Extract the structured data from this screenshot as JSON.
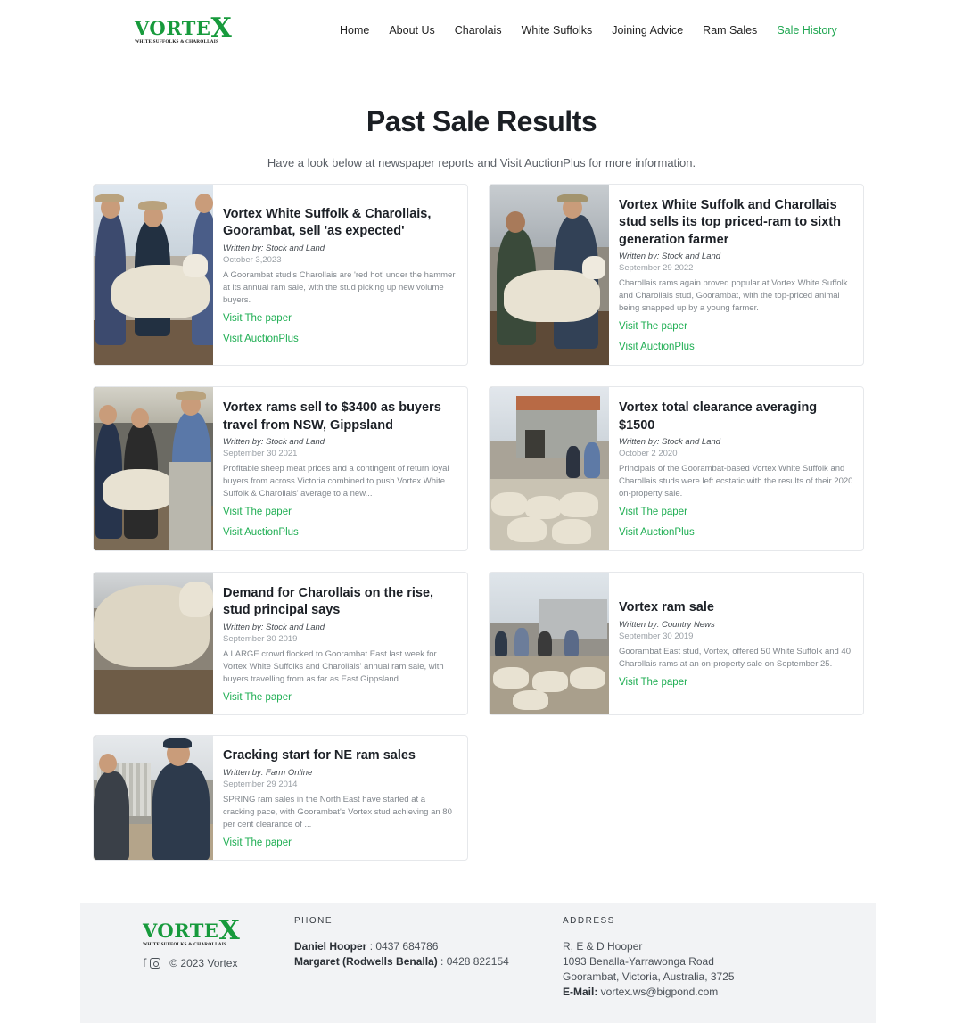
{
  "brand": {
    "name": "VORTEX",
    "tagline": "WHITE SUFFOLKS & CHAROLLAIS",
    "color": "#179a3c"
  },
  "nav": {
    "items": [
      {
        "label": "Home"
      },
      {
        "label": "About Us"
      },
      {
        "label": "Charolais"
      },
      {
        "label": "White Suffolks"
      },
      {
        "label": "Joining Advice"
      },
      {
        "label": "Ram Sales"
      },
      {
        "label": "Sale History",
        "active": true
      }
    ]
  },
  "page": {
    "title": "Past Sale Results",
    "subtitle": "Have a look below at newspaper reports and Visit AuctionPlus for more information."
  },
  "articles": [
    {
      "title": "Vortex White Suffolk & Charollais, Goorambat, sell 'as expected'",
      "written_by": "Written by: Stock and Land",
      "date": "October 3,2023",
      "summary": "A Goorambat stud's Charollais are 'red hot' under the hammer at its annual ram sale, with the stud picking up new volume buyers.",
      "paper_link": "Visit The paper",
      "auction_link": "Visit AuctionPlus"
    },
    {
      "title": "Vortex White Suffolk and Charollais stud sells its top priced-ram to sixth generation farmer",
      "written_by": "Written by: Stock and Land",
      "date": "September 29 2022",
      "summary": "Charollais rams again proved popular at Vortex White Suffolk and Charollais stud, Goorambat, with the top-priced animal being snapped up by a young farmer.",
      "paper_link": "Visit The paper",
      "auction_link": "Visit AuctionPlus"
    },
    {
      "title": "Vortex rams sell to $3400 as buyers travel from NSW, Gippsland",
      "written_by": "Written by: Stock and Land",
      "date": "September 30 2021",
      "summary": "Profitable sheep meat prices and a contingent of return loyal buyers from across Victoria combined to push Vortex White Suffolk & Charollais' average to a new...",
      "paper_link": "Visit The paper",
      "auction_link": "Visit AuctionPlus"
    },
    {
      "title": "Vortex total clearance averaging $1500",
      "written_by": "Written by: Stock and Land",
      "date": "October 2 2020",
      "summary": "Principals of the Goorambat-based Vortex White Suffolk and Charollais studs were left ecstatic with the results of their 2020 on-property sale.",
      "paper_link": "Visit The paper",
      "auction_link": "Visit AuctionPlus"
    },
    {
      "title": "Demand for Charollais on the rise, stud principal says",
      "written_by": "Written by: Stock and Land",
      "date": "September 30 2019",
      "summary": "A LARGE crowd flocked to Goorambat East last week for Vortex White Suffolks and Charollais' annual ram sale, with buyers travelling from as far as East Gippsland.",
      "paper_link": "Visit The paper"
    },
    {
      "title": "Vortex ram sale",
      "written_by": "Written by: Country News",
      "date": "September 30 2019",
      "summary": "Goorambat East stud, Vortex, offered 50 White Suffolk and 40 Charollais rams at an on-property sale on September 25.",
      "paper_link": "Visit The paper"
    },
    {
      "title": "Cracking start for NE ram sales",
      "written_by": "Written by: Farm Online",
      "date": "September 29 2014",
      "summary": "SPRING ram sales in the North East have started at a cracking pace, with Goorambat's Vortex stud achieving an 80 per cent clearance of ...",
      "paper_link": "Visit The paper"
    }
  ],
  "footer": {
    "copyright": "© 2023 Vortex",
    "phone_heading": "PHONE",
    "phones": [
      {
        "name": "Daniel Hooper",
        "number": " : 0437 684786"
      },
      {
        "name": "Margaret (Rodwells Benalla)",
        "number": " : 0428 822154"
      }
    ],
    "address_heading": "ADDRESS",
    "address_lines": [
      "R, E & D Hooper",
      "1093 Benalla-Yarrawonga Road",
      "Goorambat, Victoria, Australia, 3725"
    ],
    "email_label": "E-Mail:",
    "email": " vortex.ws@bigpond.com"
  },
  "icons": [
    "facebook-icon",
    "instagram-icon"
  ]
}
